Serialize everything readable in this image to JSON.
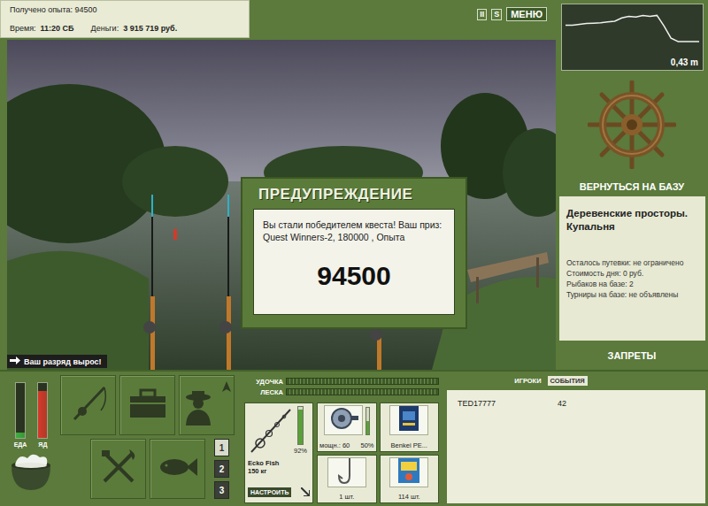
{
  "header": {
    "experience": "Получено опыта: 94500",
    "time_label": "Время:",
    "time": "11:20 СБ",
    "money_label": "Деньги:",
    "money": "3 915 719 руб.",
    "pause": "II",
    "sound": "S",
    "menu": "МЕНЮ"
  },
  "dialog": {
    "title": "ПРЕДУПРЕЖДЕНИЕ",
    "message": "Вы стали победителем квеста! Ваш приз: Quest Winners-2, 180000 , Опыта",
    "value": "94500"
  },
  "notification": {
    "text": "Ваш разряд вырос!"
  },
  "depth_chart": {
    "reading": "0,43 m",
    "values": [
      0.62,
      0.62,
      0.64,
      0.66,
      0.67,
      0.68,
      0.7,
      0.72,
      0.8,
      0.84,
      0.82,
      0.86,
      0.84,
      0.86,
      0.6,
      0.3,
      0.22,
      0.22,
      0.22,
      0.22
    ]
  },
  "base": {
    "return_button": "ВЕРНУТЬСЯ НА БАЗУ",
    "title": "Деревенские просторы. Купальня",
    "info": [
      "Осталось путевки: не ограничено",
      "Стоимость дня: 0 руб.",
      "Рыбаков на базе: 2",
      "Турниры на базе: не объявлены"
    ],
    "bans_button": "ЗАПРЕТЫ"
  },
  "meters": [
    {
      "label": "ЕДА",
      "level": 0.1,
      "color": "#3fae3f"
    },
    {
      "label": "ЯД",
      "level": 0.85,
      "color": "#d43a2a"
    }
  ],
  "slots": [
    {
      "label": "1",
      "selected": true
    },
    {
      "label": "2",
      "selected": false
    },
    {
      "label": "3",
      "selected": false
    }
  ],
  "tension": [
    {
      "label": "УДОЧКА",
      "level": 0
    },
    {
      "label": "ЛЕСКА",
      "level": 0
    }
  ],
  "tackle": {
    "rod": {
      "name": "Ecko Fish",
      "capacity": "150 кг",
      "condition": "92%",
      "level": 0.92
    },
    "configure": "НАСТРОИТЬ",
    "reel": {
      "power": "мощн.: 60",
      "wear": "50%",
      "level": 0.5
    },
    "line": {
      "name": "Benkei PE..."
    },
    "hook": {
      "count": "1 шт."
    },
    "bait": {
      "count": "114 шт."
    }
  },
  "tabs": [
    {
      "label": "ИГРОКИ",
      "selected": false
    },
    {
      "label": "СОБЫТИЯ",
      "selected": true
    }
  ],
  "players": [
    {
      "name": "TED17777",
      "value": "42"
    }
  ]
}
